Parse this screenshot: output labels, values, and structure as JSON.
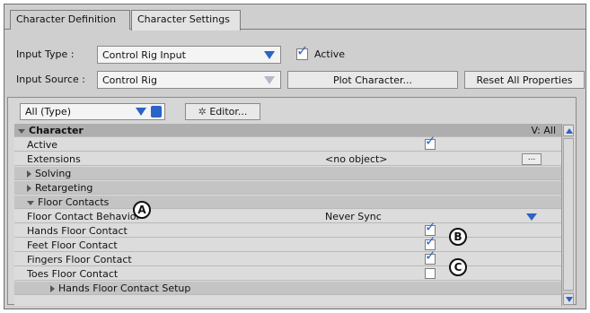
{
  "tabs": [
    "Character Definition",
    "Character Settings"
  ],
  "input_type": {
    "label": "Input Type :",
    "value": "Control Rig Input",
    "active_label": "Active",
    "active_checked": true
  },
  "input_source": {
    "label": "Input Source :",
    "value": "Control Rig"
  },
  "buttons": {
    "plot": "Plot Character...",
    "reset": "Reset All Properties",
    "editor": "Editor...",
    "ellipsis": "..."
  },
  "filter": {
    "value": "All (Type)"
  },
  "grid": {
    "header": {
      "name": "Character",
      "right": "V: All"
    },
    "rows": [
      {
        "name": "Active",
        "value": "",
        "check": true
      },
      {
        "name": "Extensions",
        "value": "<no object>",
        "ellipsis": true
      },
      {
        "name": "Solving",
        "group": true
      },
      {
        "name": "Retargeting",
        "group": true
      },
      {
        "name": "Floor Contacts",
        "group": true,
        "expanded": true
      },
      {
        "name": "Floor Contact Behavior",
        "value": "Never Sync",
        "dropdown": true
      },
      {
        "name": "Hands Floor Contact",
        "check": true
      },
      {
        "name": "Feet Floor Contact",
        "check": true
      },
      {
        "name": "Fingers Floor Contact",
        "check": true
      },
      {
        "name": "Toes Floor Contact",
        "check": false
      },
      {
        "name": "Hands Floor Contact Setup",
        "group": true,
        "sub": true
      }
    ]
  },
  "callouts": [
    "A",
    "B",
    "C"
  ],
  "colors": {
    "accent": "#2b63c6",
    "panel": "#cfcfcf"
  }
}
